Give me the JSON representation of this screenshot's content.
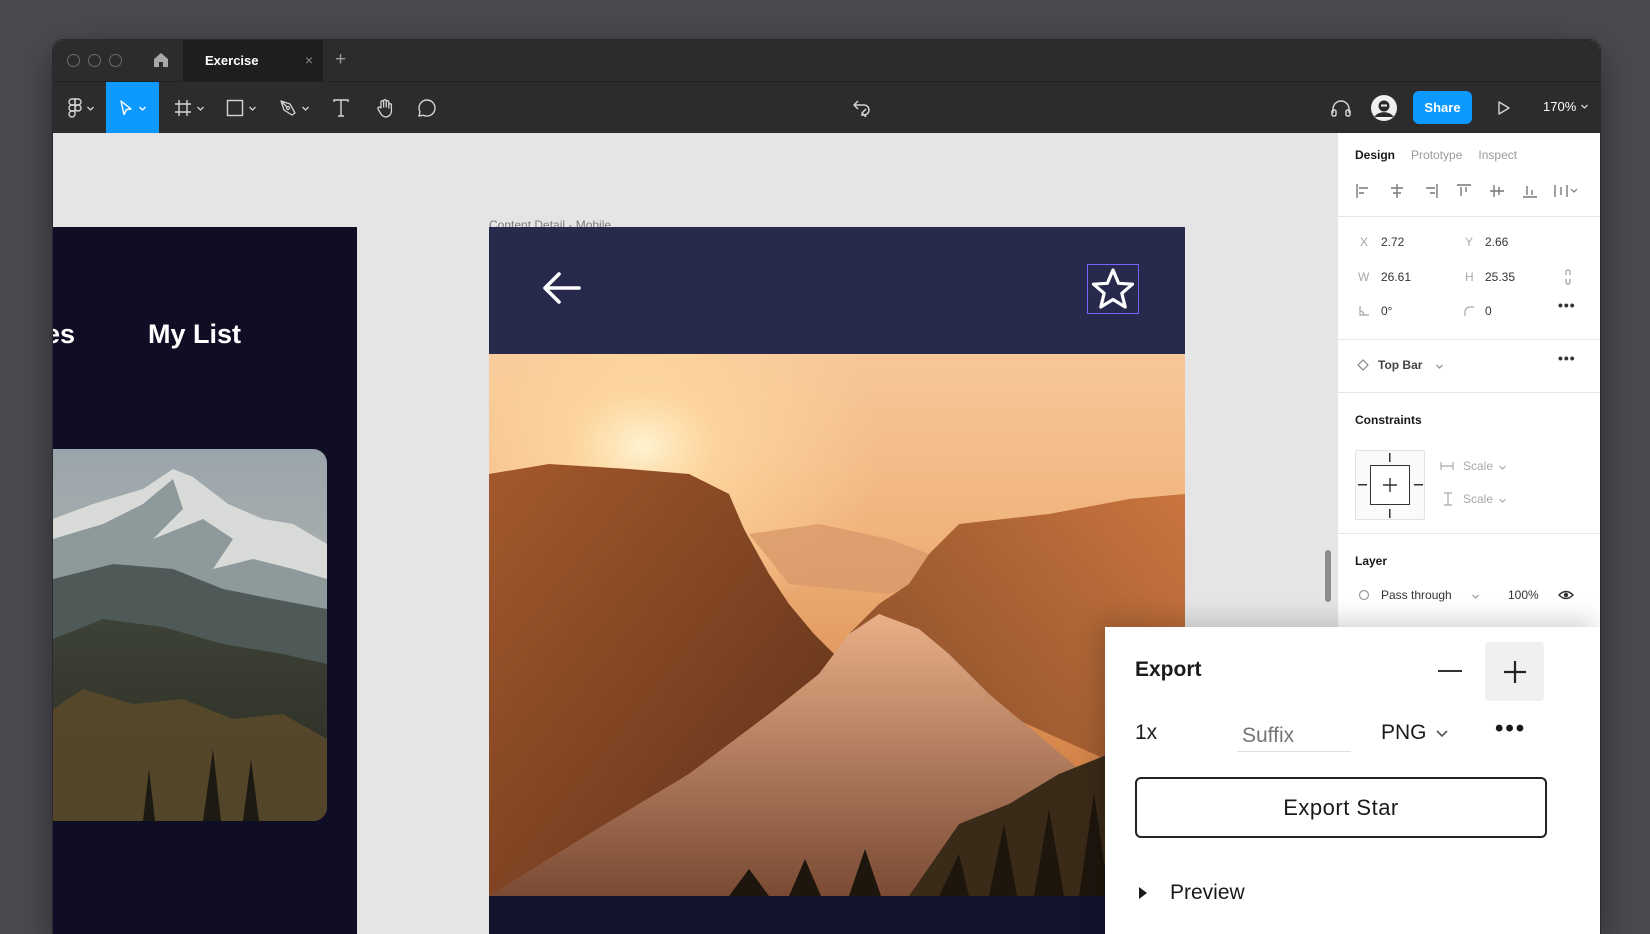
{
  "window": {
    "tab_title": "Exercise",
    "tab_close": "×",
    "new_tab": "+"
  },
  "toolbar": {
    "share_label": "Share",
    "zoom": "170%",
    "active_tool": "move"
  },
  "canvas": {
    "left_frame": {
      "nav_partial": "es",
      "nav_my_list": "My List"
    },
    "main_frame": {
      "label": "Content Detail - Mobile"
    }
  },
  "panel": {
    "tabs": [
      "Design",
      "Prototype",
      "Inspect"
    ],
    "active_tab": "Design",
    "x_label": "X",
    "x_value": "2.72",
    "y_label": "Y",
    "y_value": "2.66",
    "w_label": "W",
    "w_value": "26.61",
    "h_label": "H",
    "h_value": "25.35",
    "rotation": "0°",
    "corner_radius": "0",
    "component": "Top Bar",
    "constraints_title": "Constraints",
    "constraint_h": "Scale",
    "constraint_v": "Scale",
    "layer_title": "Layer",
    "blend_mode": "Pass through",
    "opacity": "100%",
    "more": "•••"
  },
  "export": {
    "title": "Export",
    "scale": "1x",
    "suffix_placeholder": "Suffix",
    "format": "PNG",
    "more": "•••",
    "button_label": "Export Star",
    "preview_label": "Preview"
  },
  "colors": {
    "accent": "#0d99ff",
    "toolbar_bg": "#2c2c2c",
    "frame_dark": "#0f0e24",
    "topbar_bg": "#272a4d",
    "selection": "#7b61ff"
  }
}
